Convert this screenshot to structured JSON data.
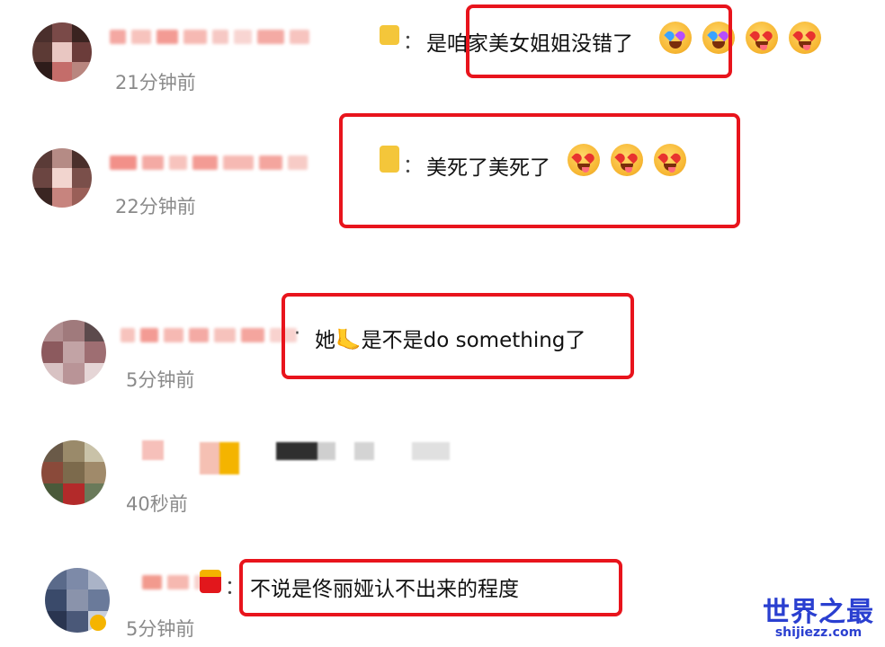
{
  "comments": [
    {
      "text": "是咱家美女姐姐没错了",
      "time": "21分钟前"
    },
    {
      "text": "美死了美死了",
      "time": "22分钟前"
    },
    {
      "text": "她🦶是不是do something了",
      "time": "5分钟前"
    },
    {
      "text": "",
      "time": "40秒前"
    },
    {
      "text": "不说是佟丽娅认不出来的程度",
      "time": "5分钟前"
    }
  ],
  "colon": "：",
  "dot": "·",
  "watermark": {
    "title": "世界之最",
    "url": "shijiezz.com"
  },
  "colors": {
    "highlight": "#e8141c",
    "watermark": "#2a3fd0",
    "time": "#8a8a8a"
  }
}
